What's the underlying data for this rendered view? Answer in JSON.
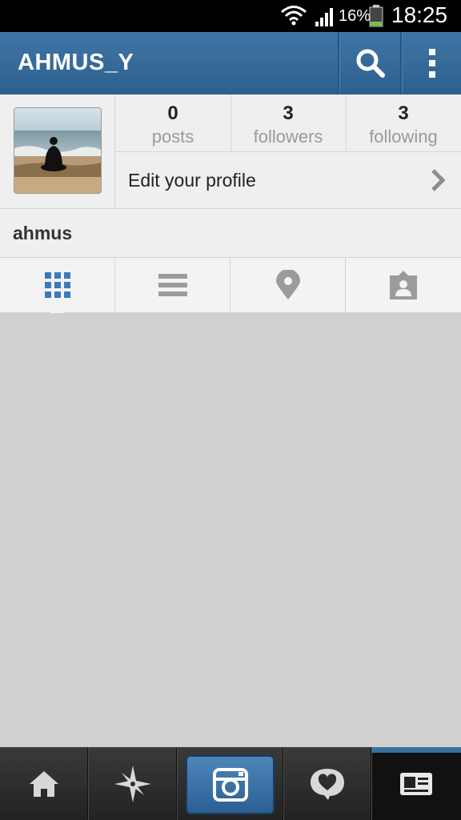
{
  "status_bar": {
    "battery_percent": "16%",
    "time": "18:25",
    "icons": [
      "wifi-icon",
      "signal-icon",
      "battery-icon"
    ]
  },
  "header": {
    "title": "AHMUS_Y",
    "actions": [
      "search-icon",
      "more-icon"
    ],
    "color": "#3a6e9f"
  },
  "profile": {
    "stats": [
      {
        "value": "0",
        "label": "posts"
      },
      {
        "value": "3",
        "label": "followers"
      },
      {
        "value": "3",
        "label": "following"
      }
    ],
    "edit_label": "Edit your profile",
    "name": "ahmus"
  },
  "view_tabs": [
    {
      "icon": "grid-icon",
      "active": true
    },
    {
      "icon": "list-icon",
      "active": false
    },
    {
      "icon": "location-pin-icon",
      "active": false
    },
    {
      "icon": "tagged-photos-icon",
      "active": false
    }
  ],
  "bottom_nav": [
    {
      "icon": "home-icon"
    },
    {
      "icon": "explore-star-icon"
    },
    {
      "icon": "camera-icon"
    },
    {
      "icon": "activity-heart-icon"
    },
    {
      "icon": "profile-card-icon",
      "active": true
    }
  ]
}
